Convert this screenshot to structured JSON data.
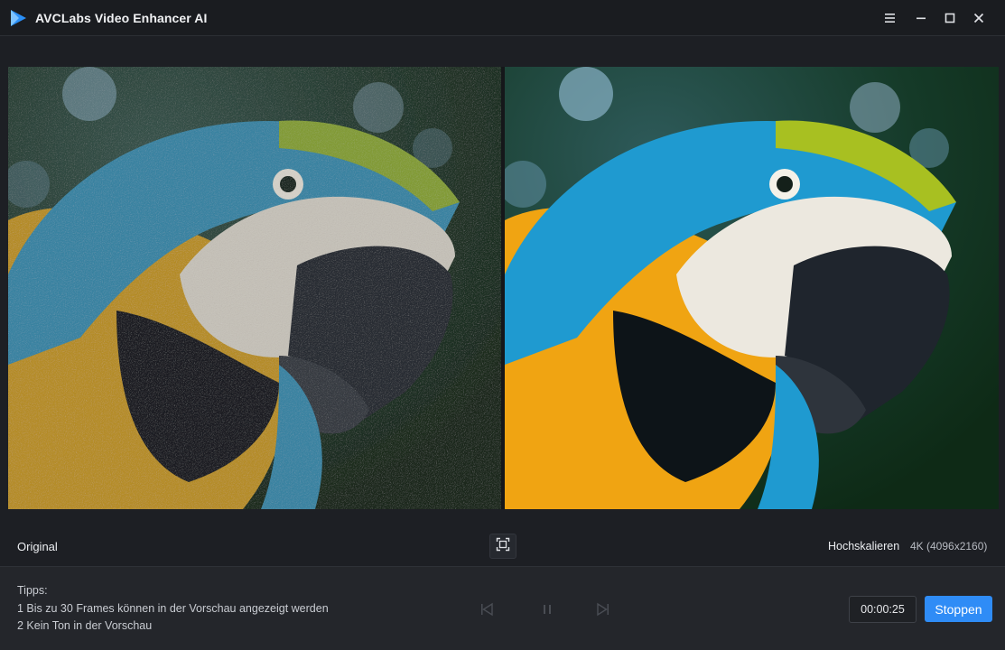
{
  "window": {
    "title": "AVCLabs Video Enhancer AI"
  },
  "preview": {
    "left_label": "Original",
    "upscale_label": "Hochskalieren",
    "resolution": "4K (4096x2160)"
  },
  "tips": {
    "title": "Tipps:",
    "items": [
      "1 Bis zu 30 Frames können in der Vorschau angezeigt werden",
      "2 Kein Ton in der Vorschau"
    ]
  },
  "playback": {
    "time": "00:00:25",
    "stop_label": "Stoppen"
  },
  "colors": {
    "accent": "#2f8cf6",
    "background": "#1d1f24",
    "panel": "#24262b"
  },
  "icons": {
    "logo": "play-triangle-logo-icon",
    "menu": "hamburger-menu-icon",
    "minimize": "minimize-icon",
    "maximize": "maximize-icon",
    "close": "close-icon",
    "fit": "fit-screen-icon",
    "prev": "skip-previous-icon",
    "pause": "pause-icon",
    "next": "skip-next-icon"
  }
}
